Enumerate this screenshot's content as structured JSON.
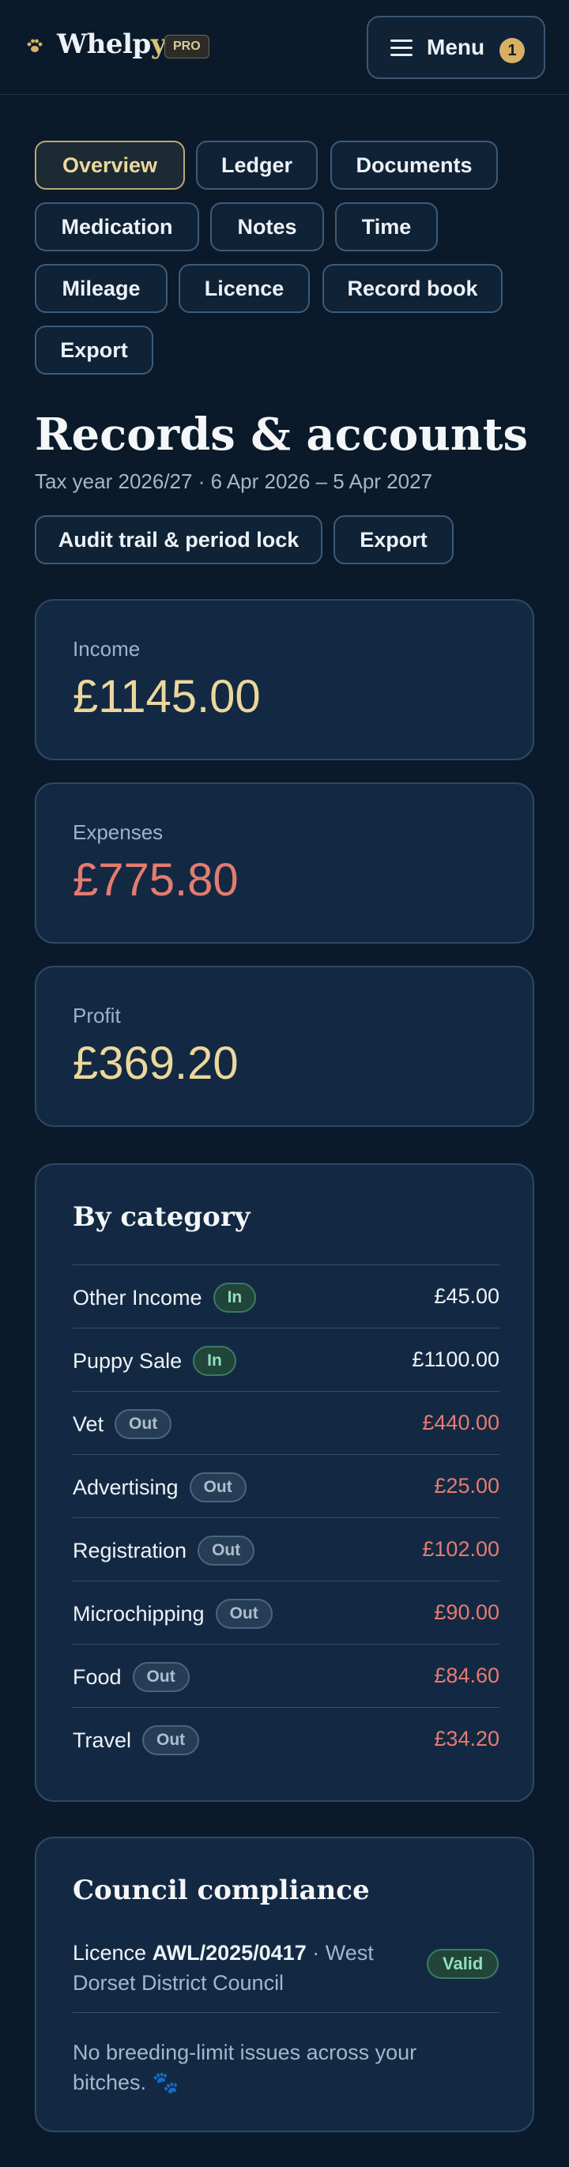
{
  "header": {
    "brand": "Whelp",
    "brand_accent": "y",
    "pro_badge": "PRO",
    "menu_label": "Menu",
    "menu_count": "1"
  },
  "tabs": [
    {
      "label": "Overview",
      "active": true
    },
    {
      "label": "Ledger"
    },
    {
      "label": "Documents"
    },
    {
      "label": "Medication"
    },
    {
      "label": "Notes"
    },
    {
      "label": "Time"
    },
    {
      "label": "Mileage"
    },
    {
      "label": "Licence"
    },
    {
      "label": "Record book"
    },
    {
      "label": "Export"
    }
  ],
  "page": {
    "title": "Records & accounts",
    "subtitle": "Tax year 2026/27 · 6 Apr 2026 – 5 Apr 2027",
    "actions": [
      "Audit trail & period lock",
      "Export"
    ]
  },
  "stats": [
    {
      "label": "Income",
      "value": "£1145.00",
      "color": "#ecd79c"
    },
    {
      "label": "Expenses",
      "value": "£775.80",
      "color": "#e57b70"
    },
    {
      "label": "Profit",
      "value": "£369.20",
      "color": "#ecd79c"
    }
  ],
  "category": {
    "title": "By category",
    "rows": [
      {
        "name": "Other Income",
        "type": "In",
        "amount": "£45.00"
      },
      {
        "name": "Puppy Sale",
        "type": "In",
        "amount": "£1100.00"
      },
      {
        "name": "Vet",
        "type": "Out",
        "amount": "£440.00"
      },
      {
        "name": "Advertising",
        "type": "Out",
        "amount": "£25.00"
      },
      {
        "name": "Registration",
        "type": "Out",
        "amount": "£102.00"
      },
      {
        "name": "Microchipping",
        "type": "Out",
        "amount": "£90.00"
      },
      {
        "name": "Food",
        "type": "Out",
        "amount": "£84.60"
      },
      {
        "name": "Travel",
        "type": "Out",
        "amount": "£34.20"
      }
    ]
  },
  "compliance": {
    "title": "Council compliance",
    "licence_prefix": "Licence",
    "licence_number": "AWL/2025/0417",
    "licence_council": "· West Dorset District Council",
    "status": "Valid",
    "note": "No breeding-limit issues across your bitches. 🐾"
  },
  "colors": {
    "accent": "#d7b066",
    "positive": "#8fe0bb",
    "negative": "#e57b70"
  }
}
